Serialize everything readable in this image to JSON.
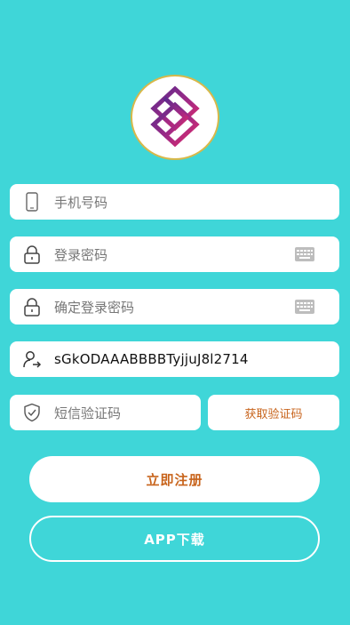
{
  "logo": {
    "name": "logo-icon",
    "colors": [
      "#6b2a8c",
      "#c0287a",
      "#e02a6a"
    ]
  },
  "form": {
    "phone": {
      "placeholder": "手机号码",
      "icon": "phone-icon"
    },
    "password": {
      "placeholder": "登录密码",
      "icon": "lock-icon",
      "trailing_icon": "keyboard-icon"
    },
    "confirm_password": {
      "placeholder": "确定登录密码",
      "icon": "lock-icon",
      "trailing_icon": "keyboard-icon"
    },
    "invite_code": {
      "value": "sGkODAAABBBBTyjjuJ8l2714",
      "icon": "user-add-icon"
    },
    "sms_code": {
      "placeholder": "短信验证码",
      "icon": "shield-check-icon"
    },
    "get_code_label": "获取验证码"
  },
  "actions": {
    "register_label": "立即注册",
    "app_download_label": "APP下载"
  },
  "colors": {
    "background": "#3fd6d8",
    "accent": "#c8641c",
    "field_bg": "#ffffff"
  }
}
